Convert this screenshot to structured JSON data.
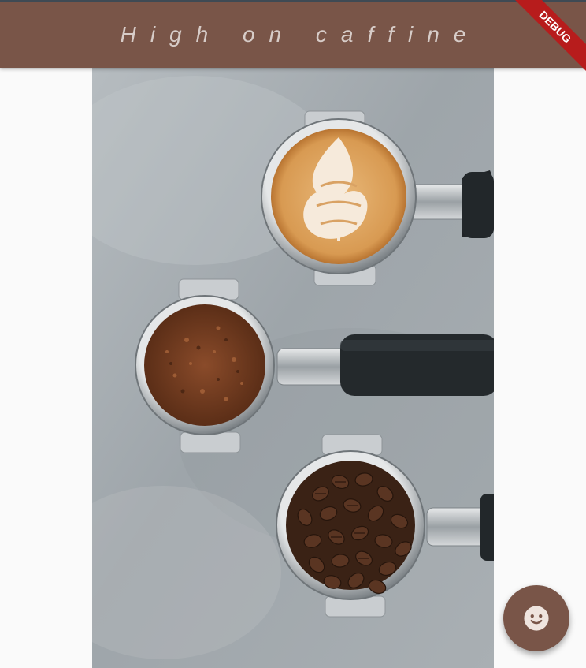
{
  "appbar": {
    "title": "High on caffine",
    "background": "#795548",
    "title_color": "#d7ccc8"
  },
  "debug_banner": {
    "label": "DEBUG",
    "color": "#b71c1c"
  },
  "content": {
    "image_subject": "coffee-portafilters-photo"
  },
  "fab": {
    "icon": "smiley-face-icon",
    "color": "#795548"
  }
}
